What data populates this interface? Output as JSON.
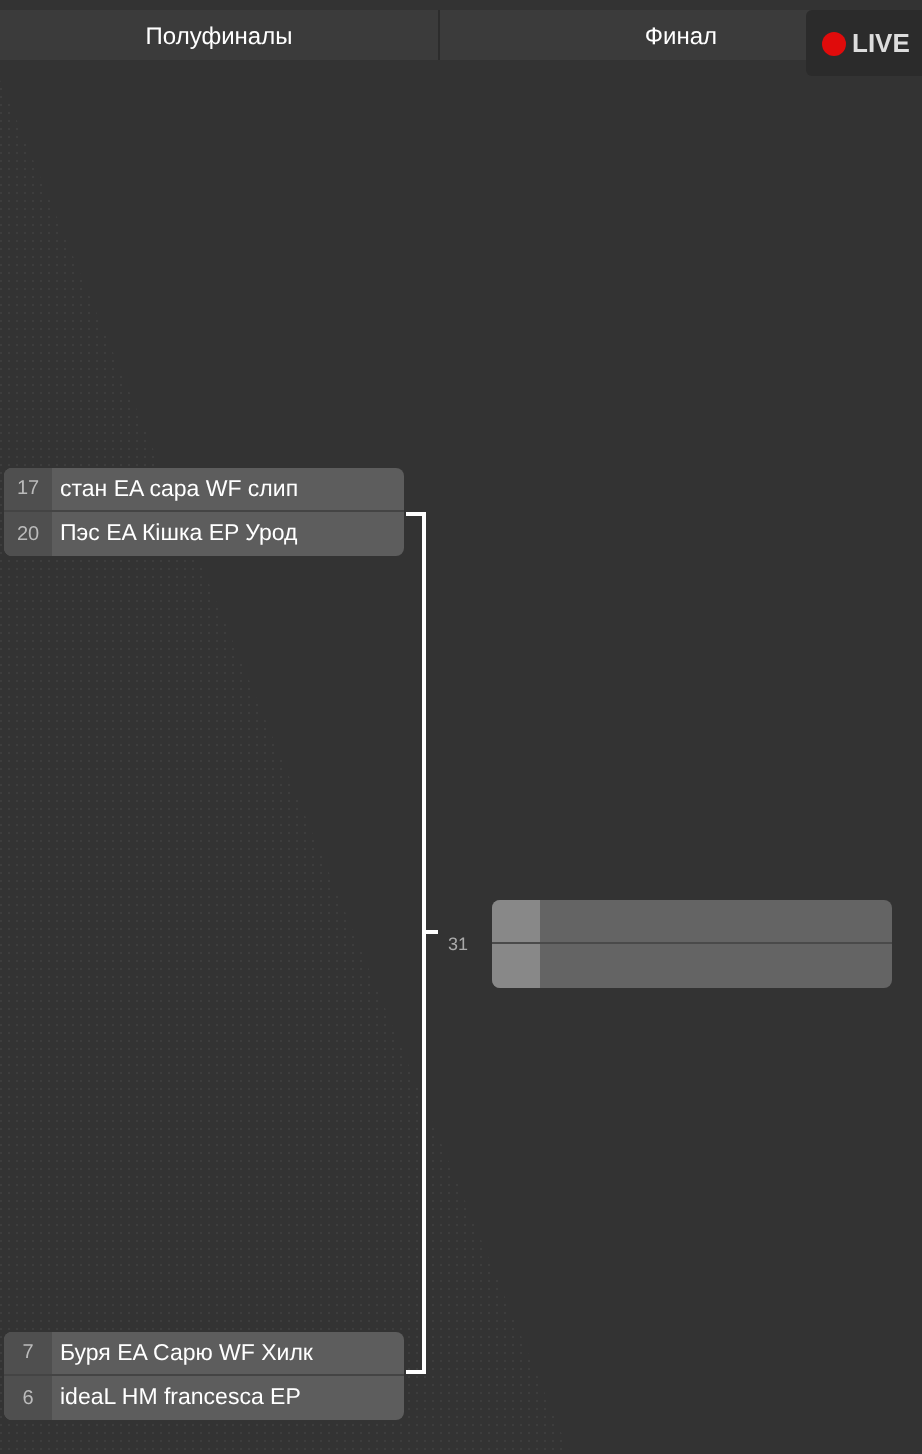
{
  "rounds": [
    {
      "title": "Полуфиналы"
    },
    {
      "title": "Финал"
    }
  ],
  "live": {
    "label": "LIVE"
  },
  "semifinal_matches": [
    {
      "teams": [
        {
          "seed": "17",
          "name": "стан EA сара WF слип"
        },
        {
          "seed": "20",
          "name": "Пэс EA Кішка EP Урод"
        }
      ]
    },
    {
      "teams": [
        {
          "seed": "7",
          "name": "Буря EA Сарю WF Хилк"
        },
        {
          "seed": "6",
          "name": "ideaL HM francesca EP"
        }
      ]
    }
  ],
  "final": {
    "match_number": "31"
  }
}
